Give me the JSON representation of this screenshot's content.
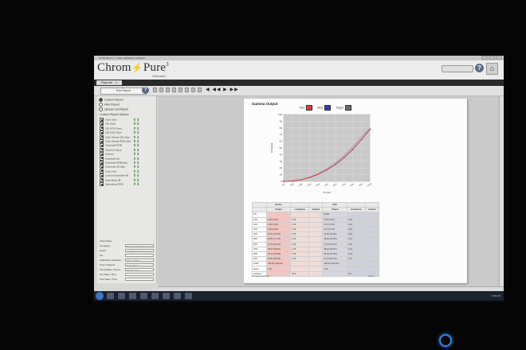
{
  "window": {
    "title": "ChromaPure 3 - Video Calibration Software"
  },
  "header": {
    "logo_main": "Chrom",
    "logo_bolt": "⚡",
    "logo_end": "Pure",
    "logo_sup": "3",
    "logo_sub": "Standard"
  },
  "tabs": [
    {
      "label": "Reports",
      "close": "x"
    }
  ],
  "toolbar": {
    "run_label": "Run Report",
    "help": "?",
    "nav": "◀ ◀◀ ▶ ▶▶"
  },
  "left_panel": {
    "radios": [
      {
        "label": "Custom Report",
        "selected": true
      },
      {
        "label": "Hide Report",
        "selected": false
      },
      {
        "label": "Upload Last Report",
        "selected": false
      }
    ],
    "list_title": "Custom Report Options",
    "items": [
      "Color Gain",
      "CIE Chart",
      "CIE 1976 Chart",
      "CIE 1931 Chart",
      "Color Sweep CIE chart",
      "Color Sweep RGB chart",
      "Grayscale RGB",
      "Gamma Output",
      "Gamma",
      "Grayscale dE",
      "Grayscale RGB data",
      "Grayscale dE data",
      "Gray Color",
      "Custom Grayscale dE",
      "Saturations dE",
      "Saturations RGB"
    ],
    "info_title": "Client Data",
    "info": [
      {
        "label": "Company",
        "value": "Display Calibrations LLC"
      },
      {
        "label": "Email",
        "value": "tom@chromapure.com"
      },
      {
        "label": "Tel",
        "value": ""
      },
      {
        "label": "Calibration Software",
        "value": "ChromaPure"
      },
      {
        "label": "Color Analyzer",
        "value": "Color Meter"
      },
      {
        "label": "Test Pattern Source",
        "value": "Test Source"
      },
      {
        "label": "Pre Date / Time",
        "value": ""
      },
      {
        "label": "Post Date / Time",
        "value": ""
      }
    ]
  },
  "report": {
    "title": "Gamma Output",
    "legend": [
      {
        "name": "Red",
        "color": "#e23b3b"
      },
      {
        "name": "Blue",
        "color": "#2a3fc9"
      },
      {
        "name": "Target",
        "color": "#6a6a6a"
      }
    ],
    "table": {
      "group_headers": [
        "",
        "Before",
        "",
        "",
        "After",
        "",
        ""
      ],
      "headers": [
        "",
        "Output",
        "Luminance",
        "Gamma",
        "Output",
        "Luminance",
        "Gamma"
      ],
      "rows": [
        [
          "0%",
          "",
          "",
          "",
          "0.003",
          "",
          ""
        ],
        [
          "10%",
          "0.56 (0.5%)",
          "2.26",
          "",
          "0.55 (0.5%)",
          "2.23",
          ""
        ],
        [
          "20%",
          "2.65 (2.4%)",
          "2.26",
          "",
          "2.57 (2.4%)",
          "2.24",
          ""
        ],
        [
          "30%",
          "6.30 (5.8%)",
          "2.26",
          "",
          "6.17 (5.7%)",
          "2.22",
          ""
        ],
        [
          "40%",
          "11.53 (10.6%)",
          "2.25",
          "",
          "11.33 (10.5%)",
          "2.22",
          ""
        ],
        [
          "50%",
          "18.61 (17.2%)",
          "2.24",
          "",
          "18.32 (16.9%)",
          "2.21",
          ""
        ],
        [
          "60%",
          "27.52 (25.4%)",
          "2.24",
          "",
          "27.23 (25.1%)",
          "2.22",
          ""
        ],
        [
          "70%",
          "38.57 (35.6%)",
          "2.25",
          "",
          "38.23 (35.3%)",
          "2.24",
          ""
        ],
        [
          "80%",
          "51.77 (47.8%)",
          "2.24",
          "",
          "51.45 (47.5%)",
          "2.23",
          ""
        ],
        [
          "90%",
          "67.51 (62.4%)",
          "2.25",
          "",
          "67.12 (62.0%)",
          "2.27",
          ""
        ],
        [
          "100%",
          "108.25 (100.0%)",
          "",
          "",
          "108.22 (100.0%)",
          "",
          ""
        ],
        [
          "Mean",
          "2.25",
          "",
          "",
          "2.23",
          "",
          ""
        ],
        [
          "Variance",
          "",
          "96.8",
          "",
          "",
          "97.1",
          ""
        ]
      ]
    },
    "footer_left": "3/17/2012 5:05 PM",
    "footer_right": "Page 1"
  },
  "chart_data": {
    "type": "line",
    "title": "Gamma Output",
    "xlabel": "% Input",
    "ylabel": "% Output",
    "x": [
      0,
      10,
      20,
      30,
      40,
      50,
      60,
      70,
      80,
      90,
      100
    ],
    "x_tick_labels": [
      "0%",
      "10%",
      "20%",
      "30%",
      "40%",
      "50%",
      "60%",
      "70%",
      "80%",
      "90%",
      "100%"
    ],
    "y_ticks": [
      0,
      10,
      20,
      30,
      40,
      50,
      60,
      70,
      80,
      90,
      100
    ],
    "xlim": [
      0,
      100
    ],
    "ylim": [
      0,
      100
    ],
    "grid": true,
    "series": [
      {
        "name": "Red",
        "color": "#e23b3b",
        "values": [
          0,
          0.5,
          2.4,
          5.8,
          10.6,
          17.2,
          25.4,
          35.6,
          47.8,
          62.4,
          78.0
        ]
      },
      {
        "name": "Blue",
        "color": "#2a3fc9",
        "values": [
          0,
          0.5,
          2.4,
          5.7,
          10.5,
          16.9,
          25.1,
          35.3,
          47.5,
          62.0,
          77.5
        ]
      },
      {
        "name": "Target",
        "color": "#8a8a8a",
        "values": [
          0,
          0.6,
          2.7,
          6.3,
          11.6,
          18.7,
          27.6,
          38.5,
          51.5,
          66.6,
          79.0
        ]
      }
    ]
  },
  "taskbar": {
    "clock": "5:05 PM"
  }
}
